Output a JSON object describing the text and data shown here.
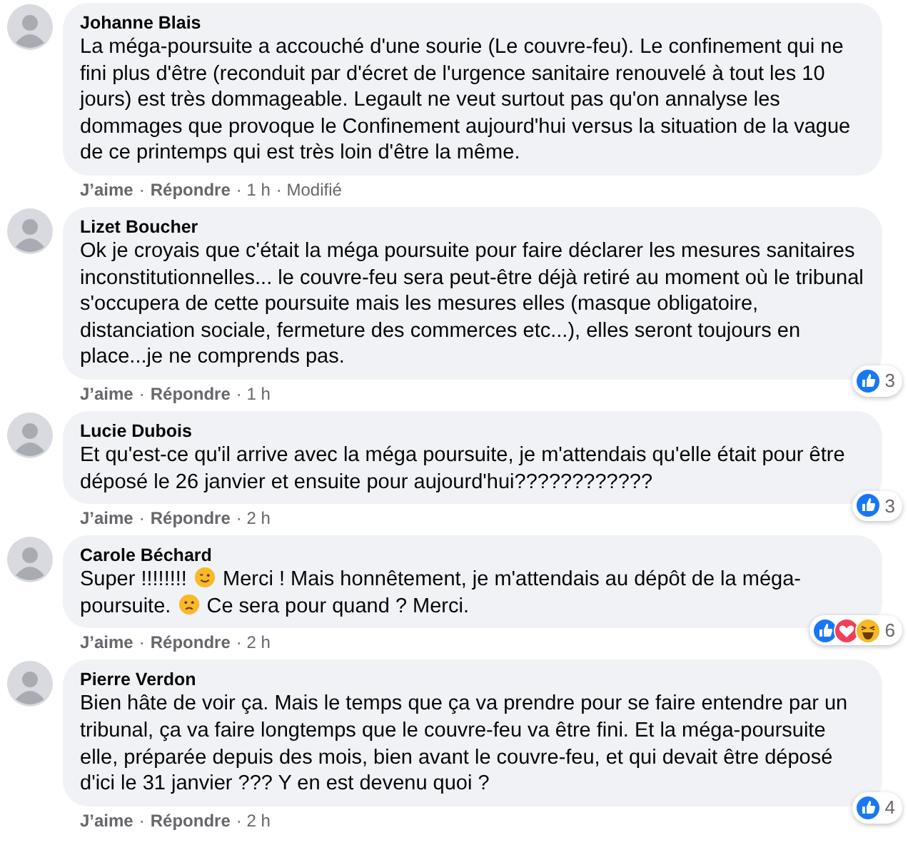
{
  "comments": [
    {
      "author": "Johanne Blais",
      "body": [
        {
          "kind": "text",
          "text": "La méga-poursuite a accouché d'une sourie (Le couvre-feu). Le confinement qui ne fini plus d'être (reconduit par d'écret de l'urgence sanitaire renouvelé à tout les 10 jours) est très dommageable. Legault ne veut surtout pas qu'on annalyse les dommages que provoque le Confinement aujourd'hui versus la situation de la vague de ce printemps qui est très loin d'être la même."
        }
      ],
      "actions": [
        {
          "kind": "link",
          "text": "J’aime"
        },
        {
          "kind": "meta",
          "text": "·"
        },
        {
          "kind": "link",
          "text": "Répondre"
        },
        {
          "kind": "meta",
          "text": "· 1 h"
        },
        {
          "kind": "meta",
          "text": "· Modifié"
        }
      ]
    },
    {
      "author": "Lizet Boucher",
      "body": [
        {
          "kind": "text",
          "text": "Ok je croyais que c'était la méga poursuite pour faire déclarer les mesures sanitaires inconstitutionnelles... le couvre-feu sera peut-être déjà retiré au moment où le tribunal s'occupera de cette poursuite mais les mesures elles (masque obligatoire, distanciation sociale, fermeture des commerces etc...), elles seront toujours en place...je ne comprends pas."
        }
      ],
      "actions": [
        {
          "kind": "link",
          "text": "J’aime"
        },
        {
          "kind": "meta",
          "text": "·"
        },
        {
          "kind": "link",
          "text": "Répondre"
        },
        {
          "kind": "meta",
          "text": "· 1 h"
        }
      ],
      "reactions": [
        {
          "kind": "like"
        }
      ],
      "reaction_count": "3"
    },
    {
      "author": "Lucie Dubois",
      "body": [
        {
          "kind": "text",
          "text": "Et qu'est-ce qu'il arrive avec la méga poursuite, je m'attendais qu'elle était pour être déposé le 26 janvier et ensuite pour aujourd'hui????????????"
        }
      ],
      "actions": [
        {
          "kind": "link",
          "text": "J’aime"
        },
        {
          "kind": "meta",
          "text": "·"
        },
        {
          "kind": "link",
          "text": "Répondre"
        },
        {
          "kind": "meta",
          "text": "· 2 h"
        }
      ],
      "reactions": [
        {
          "kind": "like"
        }
      ],
      "reaction_count": "3"
    },
    {
      "author": "Carole Béchard",
      "body": [
        {
          "kind": "text",
          "text": "Super !!!!!!!! "
        },
        {
          "kind": "wink"
        },
        {
          "kind": "text",
          "text": " Merci ! Mais honnêtement, je m'attendais au dépôt de la méga-poursuite. "
        },
        {
          "kind": "frown"
        },
        {
          "kind": "text",
          "text": " Ce sera pour quand ? Merci."
        }
      ],
      "actions": [
        {
          "kind": "link",
          "text": "J’aime"
        },
        {
          "kind": "meta",
          "text": "·"
        },
        {
          "kind": "link",
          "text": "Répondre"
        },
        {
          "kind": "meta",
          "text": "· 2 h"
        }
      ],
      "reactions": [
        {
          "kind": "like"
        },
        {
          "kind": "love"
        },
        {
          "kind": "haha"
        }
      ],
      "reaction_count": "6"
    },
    {
      "author": "Pierre Verdon",
      "body": [
        {
          "kind": "text",
          "text": "Bien hâte de voir ça. Mais le temps que ça va prendre pour se faire entendre par un tribunal, ça va faire longtemps que le couvre-feu va être fini. Et la méga-poursuite elle, préparée depuis des mois, bien avant le couvre-feu, et qui devait être déposé d'ici le 31 janvier ??? Y en est devenu quoi ?"
        }
      ],
      "actions": [
        {
          "kind": "link",
          "text": "J’aime"
        },
        {
          "kind": "meta",
          "text": "·"
        },
        {
          "kind": "link",
          "text": "Répondre"
        },
        {
          "kind": "meta",
          "text": "· 2 h"
        }
      ],
      "reactions": [
        {
          "kind": "like"
        }
      ],
      "reaction_count": "4"
    }
  ]
}
